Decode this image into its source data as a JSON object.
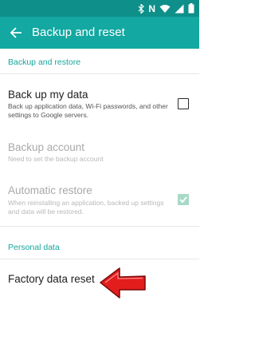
{
  "status_bar": {
    "icons": [
      "bluetooth-icon",
      "nfc-icon",
      "wifi-icon",
      "signal-icon",
      "battery-icon"
    ],
    "nfc_glyph": "N"
  },
  "app_bar": {
    "title": "Backup and reset",
    "back_icon": "arrow-left-icon"
  },
  "sections": {
    "backup_restore_header": "Backup and restore",
    "personal_data_header": "Personal data"
  },
  "items": {
    "back_up_my_data": {
      "title": "Back up my data",
      "subtitle": "Back up application data, Wi-Fi passwords, and other settings to Google servers.",
      "checked": false
    },
    "backup_account": {
      "title": "Backup account",
      "subtitle": "Need to set the backup account",
      "enabled": false
    },
    "automatic_restore": {
      "title": "Automatic restore",
      "subtitle": "When reinstalling an application, backed up settings and data will be restored.",
      "checked": true,
      "enabled": false
    },
    "factory_data_reset": {
      "title": "Factory data reset"
    }
  },
  "annotation": {
    "arrow_color": "#e31c1c",
    "arrow_icon": "red-arrow-pointer-icon"
  },
  "colors": {
    "status_bar": "#0e8f8a",
    "app_bar": "#13a8a1",
    "accent": "#18a59d"
  }
}
